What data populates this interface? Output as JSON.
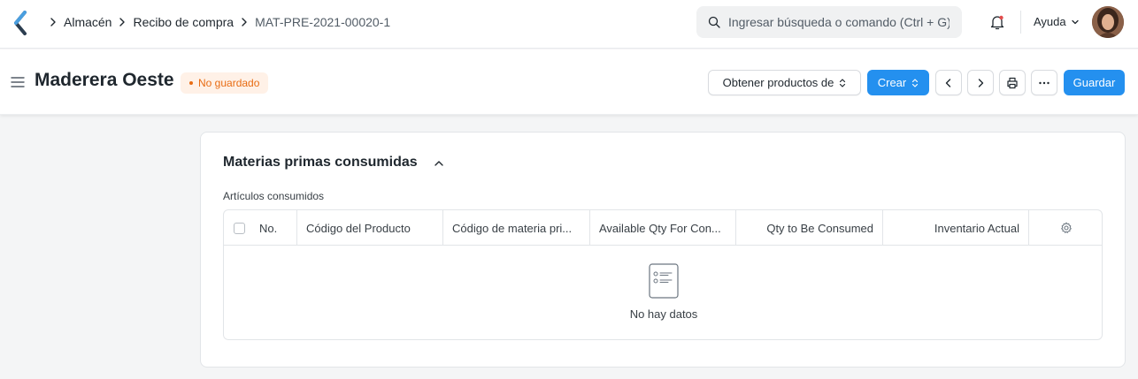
{
  "navbar": {
    "breadcrumbs": [
      "Almacén",
      "Recibo de compra",
      "MAT-PRE-2021-00020-1"
    ],
    "search_placeholder": "Ingresar búsqueda o comando (Ctrl + G)",
    "help_label": "Ayuda"
  },
  "page": {
    "title": "Maderera Oeste",
    "status_badge": "No guardado",
    "actions": {
      "get_items_label": "Obtener productos de",
      "create_label": "Crear",
      "save_label": "Guardar"
    }
  },
  "section": {
    "title": "Materias primas consumidas",
    "field_label": "Artículos consumidos",
    "columns": [
      "No.",
      "Código del Producto",
      "Código de materia pri...",
      "Available Qty For Con...",
      "Qty to Be Consumed",
      "Inventario Actual"
    ],
    "empty_text": "No hay datos"
  },
  "colors": {
    "primary": "#2490ef",
    "badge_text": "#e86c13",
    "badge_bg": "#fff1e7"
  }
}
